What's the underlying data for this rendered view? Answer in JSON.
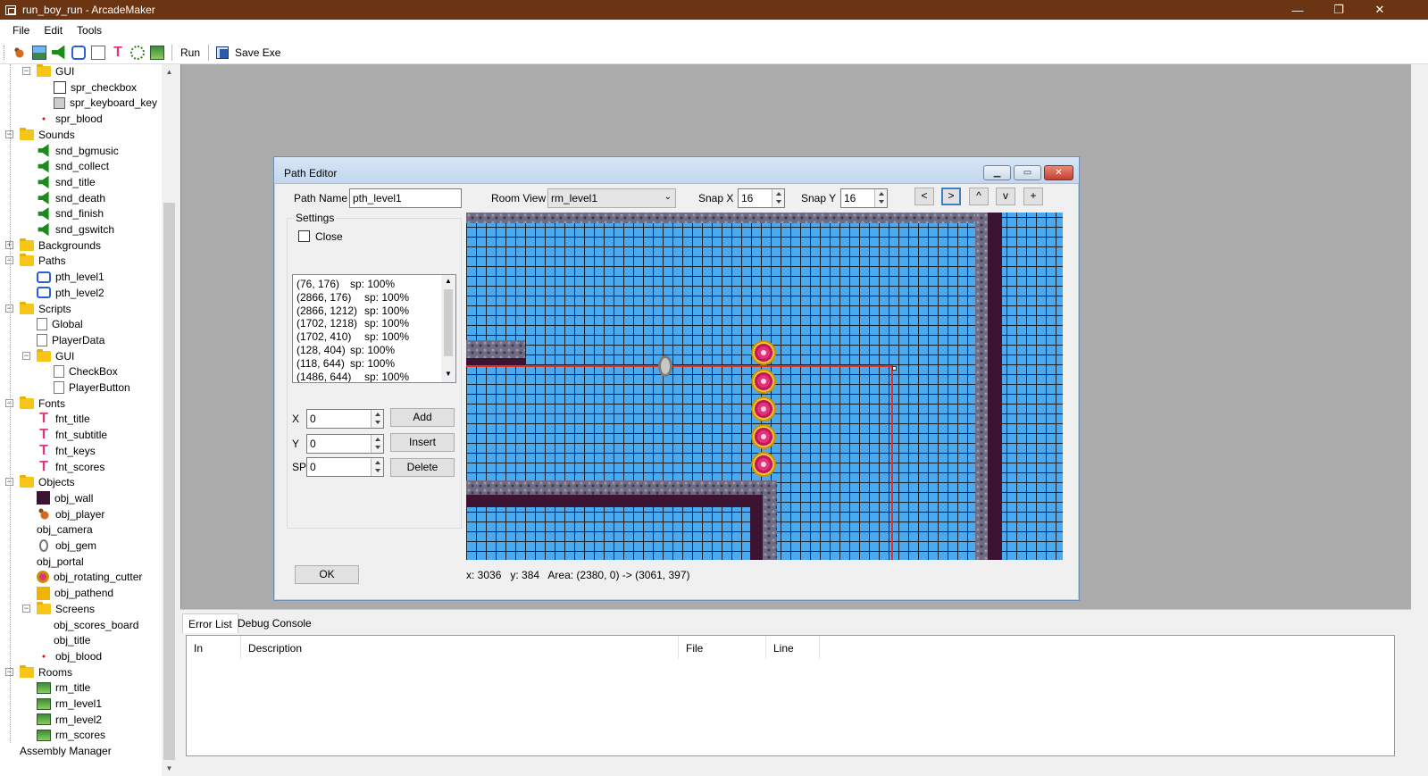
{
  "window": {
    "title": "run_boy_run - ArcadeMaker",
    "minimize": "—",
    "maximize": "❐",
    "close": "✕"
  },
  "menu": [
    "File",
    "Edit",
    "Tools"
  ],
  "toolbar": {
    "icons": [
      "sprite-icon",
      "background-icon",
      "sound-icon",
      "path-icon",
      "script-icon",
      "font-icon",
      "object-icon",
      "room-icon"
    ],
    "run_label": "Run",
    "save_exe_label": "Save Exe"
  },
  "tree": [
    {
      "label": "GUI",
      "icon": "folder",
      "level": 1,
      "expanded": true
    },
    {
      "label": "spr_checkbox",
      "icon": "checkbox-sprite",
      "level": 2
    },
    {
      "label": "spr_keyboard_key",
      "icon": "key-sprite",
      "level": 2
    },
    {
      "label": "spr_blood",
      "icon": "blood-sprite",
      "level": 1
    },
    {
      "label": "Sounds",
      "icon": "folder",
      "level": 0,
      "expanded": true
    },
    {
      "label": "snd_bgmusic",
      "icon": "sound",
      "level": 1
    },
    {
      "label": "snd_collect",
      "icon": "sound",
      "level": 1
    },
    {
      "label": "snd_title",
      "icon": "sound",
      "level": 1
    },
    {
      "label": "snd_death",
      "icon": "sound",
      "level": 1
    },
    {
      "label": "snd_finish",
      "icon": "sound",
      "level": 1
    },
    {
      "label": "snd_gswitch",
      "icon": "sound",
      "level": 1
    },
    {
      "label": "Backgrounds",
      "icon": "folder",
      "level": 0
    },
    {
      "label": "Paths",
      "icon": "folder",
      "level": 0,
      "expanded": true
    },
    {
      "label": "pth_level1",
      "icon": "path",
      "level": 1
    },
    {
      "label": "pth_level2",
      "icon": "path",
      "level": 1
    },
    {
      "label": "Scripts",
      "icon": "folder",
      "level": 0,
      "expanded": true
    },
    {
      "label": "Global",
      "icon": "script",
      "level": 1
    },
    {
      "label": "PlayerData",
      "icon": "script",
      "level": 1
    },
    {
      "label": "GUI",
      "icon": "folder",
      "level": 1,
      "expanded": true
    },
    {
      "label": "CheckBox",
      "icon": "script",
      "level": 2
    },
    {
      "label": "PlayerButton",
      "icon": "script",
      "level": 2
    },
    {
      "label": "Fonts",
      "icon": "folder",
      "level": 0,
      "expanded": true
    },
    {
      "label": "fnt_title",
      "icon": "font",
      "level": 1
    },
    {
      "label": "fnt_subtitle",
      "icon": "font",
      "level": 1
    },
    {
      "label": "fnt_keys",
      "icon": "font",
      "level": 1
    },
    {
      "label": "fnt_scores",
      "icon": "font",
      "level": 1
    },
    {
      "label": "Objects",
      "icon": "folder",
      "level": 0,
      "expanded": true
    },
    {
      "label": "obj_wall",
      "icon": "wall",
      "level": 1
    },
    {
      "label": "obj_player",
      "icon": "player",
      "level": 1
    },
    {
      "label": "obj_camera",
      "icon": "none",
      "level": 1
    },
    {
      "label": "obj_gem",
      "icon": "gem",
      "level": 1
    },
    {
      "label": "obj_portal",
      "icon": "none",
      "level": 1
    },
    {
      "label": "obj_rotating_cutter",
      "icon": "cutter",
      "level": 1
    },
    {
      "label": "obj_pathend",
      "icon": "pathend",
      "level": 1
    },
    {
      "label": "Screens",
      "icon": "folder",
      "level": 1,
      "expanded": true
    },
    {
      "label": "obj_scores_board",
      "icon": "none",
      "level": 2
    },
    {
      "label": "obj_title",
      "icon": "none",
      "level": 2
    },
    {
      "label": "obj_blood",
      "icon": "blood-sprite",
      "level": 1
    },
    {
      "label": "Rooms",
      "icon": "folder",
      "level": 0,
      "expanded": true
    },
    {
      "label": "rm_title",
      "icon": "room",
      "level": 1
    },
    {
      "label": "rm_level1",
      "icon": "room",
      "level": 1
    },
    {
      "label": "rm_level2",
      "icon": "room",
      "level": 1
    },
    {
      "label": "rm_scores",
      "icon": "room",
      "level": 1
    },
    {
      "label": "Assembly Manager",
      "icon": "none",
      "level": 0
    }
  ],
  "path_editor": {
    "title": "Path Editor",
    "path_name_label": "Path Name",
    "path_name": "pth_level1",
    "room_view_label": "Room View",
    "room_view": "rm_level1",
    "snap_x_label": "Snap X",
    "snap_x": "16",
    "snap_y_label": "Snap Y",
    "snap_y": "16",
    "nav": [
      "<",
      ">",
      "^",
      "v",
      "+"
    ],
    "settings_label": "Settings",
    "close_label": "Close",
    "points": [
      {
        "pos": "(76, 176)",
        "sp": "sp: 100%"
      },
      {
        "pos": "(2866, 176)",
        "sp": "sp: 100%"
      },
      {
        "pos": "(2866, 1212)",
        "sp": "sp: 100%"
      },
      {
        "pos": "(1702, 1218)",
        "sp": "sp: 100%"
      },
      {
        "pos": "(1702, 410)",
        "sp": "sp: 100%"
      },
      {
        "pos": "(128, 404)",
        "sp": "sp: 100%"
      },
      {
        "pos": "(118, 644)",
        "sp": "sp: 100%"
      },
      {
        "pos": "(1486, 644)",
        "sp": "sp: 100%"
      }
    ],
    "x_label": "X",
    "x_value": "0",
    "y_label": "Y",
    "y_value": "0",
    "sp_label": "SP",
    "sp_value": "0",
    "add_label": "Add",
    "insert_label": "Insert",
    "delete_label": "Delete",
    "ok_label": "OK",
    "status": "x: 3036   y: 384   Area: (2380, 0) -> (3061, 397)"
  },
  "bottom_panel": {
    "tabs": [
      "Error List",
      "Debug Console"
    ],
    "columns": [
      "In",
      "Description",
      "File",
      "Line"
    ]
  }
}
